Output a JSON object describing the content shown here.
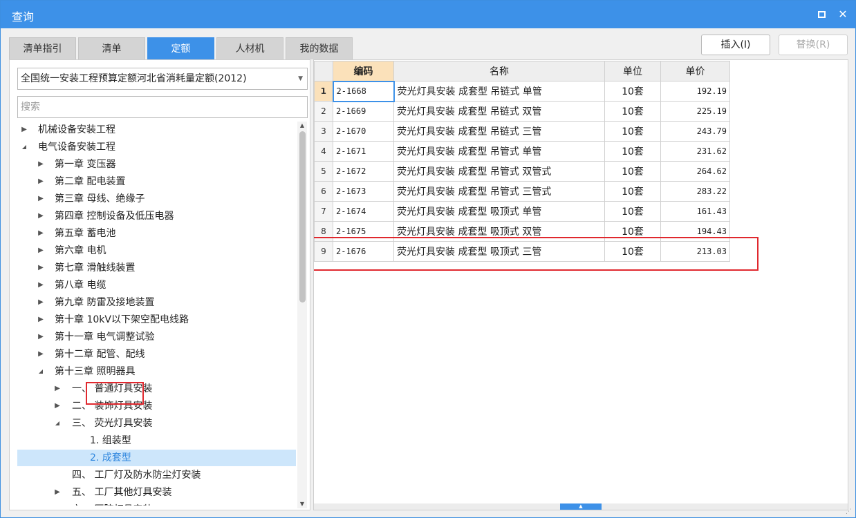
{
  "window": {
    "title": "查询"
  },
  "tabs": [
    "清单指引",
    "清单",
    "定额",
    "人材机",
    "我的数据"
  ],
  "active_tab_index": 2,
  "buttons": {
    "insert": "插入(I)",
    "replace": "替换(R)"
  },
  "left": {
    "quota_library": "全国统一安装工程预算定额河北省消耗量定额(2012)",
    "search_placeholder": "搜索",
    "tree": [
      {
        "label": "机械设备安装工程",
        "level": 0,
        "state": "collapsed"
      },
      {
        "label": "电气设备安装工程",
        "level": 0,
        "state": "expanded"
      },
      {
        "label": "第一章 变压器",
        "level": 1,
        "state": "collapsed"
      },
      {
        "label": "第二章 配电装置",
        "level": 1,
        "state": "collapsed"
      },
      {
        "label": "第三章 母线、绝缘子",
        "level": 1,
        "state": "collapsed"
      },
      {
        "label": "第四章 控制设备及低压电器",
        "level": 1,
        "state": "collapsed"
      },
      {
        "label": "第五章 蓄电池",
        "level": 1,
        "state": "collapsed"
      },
      {
        "label": "第六章 电机",
        "level": 1,
        "state": "collapsed"
      },
      {
        "label": "第七章 滑触线装置",
        "level": 1,
        "state": "collapsed"
      },
      {
        "label": "第八章 电缆",
        "level": 1,
        "state": "collapsed"
      },
      {
        "label": "第九章 防雷及接地装置",
        "level": 1,
        "state": "collapsed"
      },
      {
        "label": "第十章 10kV以下架空配电线路",
        "level": 1,
        "state": "collapsed"
      },
      {
        "label": "第十一章 电气调整试验",
        "level": 1,
        "state": "collapsed"
      },
      {
        "label": "第十二章 配管、配线",
        "level": 1,
        "state": "collapsed"
      },
      {
        "label": "第十三章 照明器具",
        "level": 1,
        "state": "expanded"
      },
      {
        "label": "一、 普通灯具安装",
        "level": 2,
        "state": "collapsed"
      },
      {
        "label": "二、 装饰灯具安装",
        "level": 2,
        "state": "collapsed"
      },
      {
        "label": "三、 荧光灯具安装",
        "level": 2,
        "state": "expanded"
      },
      {
        "label": "1. 组装型",
        "level": 3,
        "state": "leaf"
      },
      {
        "label": "2. 成套型",
        "level": 3,
        "state": "leaf",
        "selected": true
      },
      {
        "label": "四、 工厂灯及防水防尘灯安装",
        "level": 2,
        "state": "leaf"
      },
      {
        "label": "五、 工厂其他灯具安装",
        "level": 2,
        "state": "collapsed"
      },
      {
        "label": "六、 医院灯具安装",
        "level": 2,
        "state": "collapsed"
      }
    ]
  },
  "table": {
    "columns": [
      "编码",
      "名称",
      "单位",
      "单价"
    ],
    "rows": [
      {
        "n": "1",
        "code": "2-1668",
        "name": "荧光灯具安装 成套型 吊链式 单管",
        "unit": "10套",
        "price": "192.19"
      },
      {
        "n": "2",
        "code": "2-1669",
        "name": "荧光灯具安装 成套型 吊链式 双管",
        "unit": "10套",
        "price": "225.19"
      },
      {
        "n": "3",
        "code": "2-1670",
        "name": "荧光灯具安装 成套型 吊链式 三管",
        "unit": "10套",
        "price": "243.79"
      },
      {
        "n": "4",
        "code": "2-1671",
        "name": "荧光灯具安装 成套型 吊管式 单管",
        "unit": "10套",
        "price": "231.62"
      },
      {
        "n": "5",
        "code": "2-1672",
        "name": "荧光灯具安装 成套型 吊管式 双管式",
        "unit": "10套",
        "price": "264.62"
      },
      {
        "n": "6",
        "code": "2-1673",
        "name": "荧光灯具安装 成套型 吊管式 三管式",
        "unit": "10套",
        "price": "283.22"
      },
      {
        "n": "7",
        "code": "2-1674",
        "name": "荧光灯具安装 成套型 吸顶式 单管",
        "unit": "10套",
        "price": "161.43"
      },
      {
        "n": "8",
        "code": "2-1675",
        "name": "荧光灯具安装 成套型 吸顶式 双管",
        "unit": "10套",
        "price": "194.43"
      },
      {
        "n": "9",
        "code": "2-1676",
        "name": "荧光灯具安装 成套型 吸顶式 三管",
        "unit": "10套",
        "price": "213.03"
      }
    ]
  },
  "colors": {
    "accent": "#3d91e8",
    "highlight_border": "#e0282e",
    "selected_bg": "#cde6fb",
    "sorted_header": "#fbe1ba"
  }
}
